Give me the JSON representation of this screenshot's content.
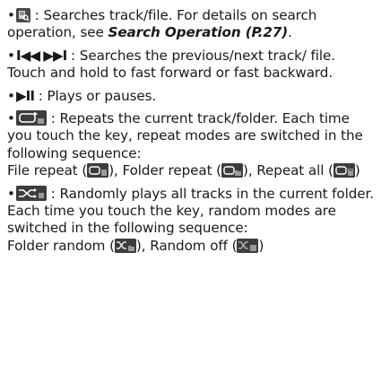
{
  "bullet": "•",
  "items": [
    {
      "icon": "search-icon",
      "text_before_ref": " : Searches track/file. For details on search operation, see ",
      "ref": "Search Operation (P.27)",
      "text_after_ref": "."
    },
    {
      "symbols": "I◀◀  ▶▶I",
      "text": " : Searches the previous/next track/ file.",
      "line2": "Touch and hold to fast forward or fast backward."
    },
    {
      "symbols": "▶II",
      "text": " : Plays or pauses."
    },
    {
      "icon": "repeat-icon",
      "text": " : Repeats the current track/folder. Each time you touch the key, repeat modes are switched in the following sequence:",
      "seq": [
        {
          "label": "File repeat (",
          "icon": "file-repeat-icon",
          "close": "), "
        },
        {
          "label": "Folder repeat (",
          "icon": "folder-repeat-icon",
          "close": "), "
        },
        {
          "label": "Repeat all (",
          "icon": "repeat-all-icon",
          "close": ")"
        }
      ]
    },
    {
      "icon": "random-icon",
      "text": " : Randomly plays all tracks in the current folder. Each time you touch the key, random modes are switched in the following sequence:",
      "seq": [
        {
          "label": "Folder random (",
          "icon": "folder-random-icon",
          "close": "), "
        },
        {
          "label": "Random off (",
          "icon": "random-off-icon",
          "close": ")"
        }
      ]
    }
  ]
}
